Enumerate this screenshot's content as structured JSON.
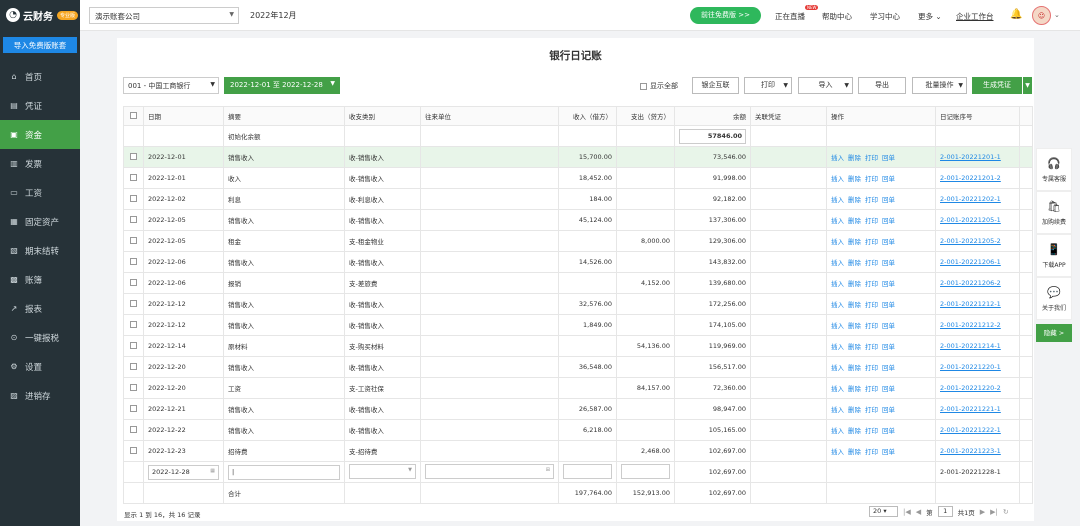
{
  "app": {
    "logo_text": "云财务",
    "logo_badge": "专业版"
  },
  "sidebar": {
    "import_btn": "导入免费版账套",
    "items": [
      {
        "label": "首页",
        "icon": "home-icon"
      },
      {
        "label": "凭证",
        "icon": "voucher-icon"
      },
      {
        "label": "资金",
        "icon": "fund-icon"
      },
      {
        "label": "发票",
        "icon": "invoice-icon"
      },
      {
        "label": "工资",
        "icon": "salary-icon"
      },
      {
        "label": "固定资产",
        "icon": "asset-icon"
      },
      {
        "label": "期末结转",
        "icon": "transfer-icon"
      },
      {
        "label": "账簿",
        "icon": "ledger-icon"
      },
      {
        "label": "报表",
        "icon": "report-icon"
      },
      {
        "label": "一键报税",
        "icon": "tax-icon"
      },
      {
        "label": "设置",
        "icon": "settings-icon"
      },
      {
        "label": "进销存",
        "icon": "inventory-icon"
      }
    ]
  },
  "topbar": {
    "company": "演示账套公司",
    "period": "2022年12月",
    "free_btn": "前往免费版 >>",
    "live": "正在直播",
    "live_badge": "NEW",
    "help": "帮助中心",
    "learn": "学习中心",
    "more": "更多",
    "workspace": "企业工作台"
  },
  "page": {
    "title": "银行日记账"
  },
  "toolbar": {
    "account": "001 - 中国工商银行",
    "date_range": "2022-12-01 至 2022-12-28",
    "show_all": "显示全部",
    "bank_link": "银企互联",
    "print": "打印",
    "import": "导入",
    "export": "导出",
    "batch": "批量操作",
    "generate": "生成凭证"
  },
  "table": {
    "headers": [
      "日期",
      "摘要",
      "收支类别",
      "往来单位",
      "收入（借方）",
      "支出（贷方）",
      "余额",
      "关联凭证",
      "操作",
      "日记账序号"
    ],
    "init_label": "初始化余额",
    "init_balance": "57846.00",
    "ops": [
      "插入",
      "删除",
      "打印",
      "回单"
    ],
    "rows": [
      {
        "date": "2022-12-01",
        "summary": "销售收入",
        "category": "收-销售收入",
        "income": "15,700.00",
        "expense": "",
        "balance": "73,546.00",
        "seq": "2-001-20221201-1"
      },
      {
        "date": "2022-12-01",
        "summary": "收入",
        "category": "收-销售收入",
        "income": "18,452.00",
        "expense": "",
        "balance": "91,998.00",
        "seq": "2-001-20221201-2"
      },
      {
        "date": "2022-12-02",
        "summary": "利息",
        "category": "收-利息收入",
        "income": "184.00",
        "expense": "",
        "balance": "92,182.00",
        "seq": "2-001-20221202-1"
      },
      {
        "date": "2022-12-05",
        "summary": "销售收入",
        "category": "收-销售收入",
        "income": "45,124.00",
        "expense": "",
        "balance": "137,306.00",
        "seq": "2-001-20221205-1"
      },
      {
        "date": "2022-12-05",
        "summary": "租金",
        "category": "支-租金物业",
        "income": "",
        "expense": "8,000.00",
        "balance": "129,306.00",
        "seq": "2-001-20221205-2"
      },
      {
        "date": "2022-12-06",
        "summary": "销售收入",
        "category": "收-销售收入",
        "income": "14,526.00",
        "expense": "",
        "balance": "143,832.00",
        "seq": "2-001-20221206-1"
      },
      {
        "date": "2022-12-06",
        "summary": "报销",
        "category": "支-差旅费",
        "income": "",
        "expense": "4,152.00",
        "balance": "139,680.00",
        "seq": "2-001-20221206-2"
      },
      {
        "date": "2022-12-12",
        "summary": "销售收入",
        "category": "收-销售收入",
        "income": "32,576.00",
        "expense": "",
        "balance": "172,256.00",
        "seq": "2-001-20221212-1"
      },
      {
        "date": "2022-12-12",
        "summary": "销售收入",
        "category": "收-销售收入",
        "income": "1,849.00",
        "expense": "",
        "balance": "174,105.00",
        "seq": "2-001-20221212-2"
      },
      {
        "date": "2022-12-14",
        "summary": "原材料",
        "category": "支-购买材料",
        "income": "",
        "expense": "54,136.00",
        "balance": "119,969.00",
        "seq": "2-001-20221214-1"
      },
      {
        "date": "2022-12-20",
        "summary": "销售收入",
        "category": "收-销售收入",
        "income": "36,548.00",
        "expense": "",
        "balance": "156,517.00",
        "seq": "2-001-20221220-1"
      },
      {
        "date": "2022-12-20",
        "summary": "工资",
        "category": "支-工资社保",
        "income": "",
        "expense": "84,157.00",
        "balance": "72,360.00",
        "seq": "2-001-20221220-2"
      },
      {
        "date": "2022-12-21",
        "summary": "销售收入",
        "category": "收-销售收入",
        "income": "26,587.00",
        "expense": "",
        "balance": "98,947.00",
        "seq": "2-001-20221221-1"
      },
      {
        "date": "2022-12-22",
        "summary": "销售收入",
        "category": "收-销售收入",
        "income": "6,218.00",
        "expense": "",
        "balance": "105,165.00",
        "seq": "2-001-20221222-1"
      },
      {
        "date": "2022-12-23",
        "summary": "招待费",
        "category": "支-招待费",
        "income": "",
        "expense": "2,468.00",
        "balance": "102,697.00",
        "seq": "2-001-20221223-1"
      }
    ],
    "new_row": {
      "date": "2022-12-28",
      "balance": "102,697.00",
      "seq": "2-001-20221228-1"
    },
    "total": {
      "label": "合计",
      "income": "197,764.00",
      "expense": "152,913.00",
      "balance": "102,697.00"
    }
  },
  "footer": {
    "info": "显示 1 到 16，共 16 记录",
    "page_size": "20",
    "page_prefix": "第",
    "page_num": "1",
    "page_suffix": "共1页"
  },
  "float": {
    "items": [
      {
        "label": "专属客服",
        "icon": "headset-icon"
      },
      {
        "label": "加购续费",
        "icon": "cart-icon"
      },
      {
        "label": "下载APP",
        "icon": "phone-icon"
      },
      {
        "label": "关于我们",
        "icon": "wechat-icon"
      }
    ],
    "hide": "隐藏 >"
  }
}
